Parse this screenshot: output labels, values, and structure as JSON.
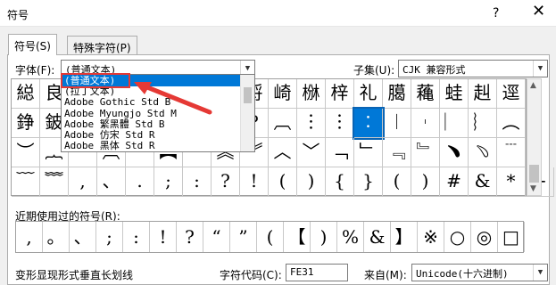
{
  "window": {
    "title": "符号",
    "help": "?",
    "close": "✕"
  },
  "tabs": [
    {
      "label": "符号(S)",
      "active": true
    },
    {
      "label": "特殊字符(P)",
      "active": false
    }
  ],
  "font": {
    "label": "字体(F):",
    "value": "(普通文本)"
  },
  "subset": {
    "label": "子集(U):",
    "value": "CJK 兼容形式"
  },
  "dropdown_items": [
    "(普通文本)",
    "(拉丁文本)",
    "Adobe Gothic Std B",
    "Adobe Myungjo Std M",
    "Adobe 繁黑體 Std B",
    "Adobe 仿宋 Std R",
    "Adobe 黑体 Std R"
  ],
  "grid_rows": [
    [
      "縂",
      "良",
      "",
      "",
      "",
      "",
      "",
      "",
      "埒",
      "崎",
      "椕",
      "梓",
      "礼",
      "臈",
      "蘒",
      "蛙",
      "赳",
      "逕"
    ],
    [
      "錚",
      "鈹",
      "",
      "",
      "",
      "",
      "",
      "",
      "?",
      "︹",
      "︙",
      "︙",
      "︰",
      "︱",
      "︲",
      "︳",
      "︴",
      "︵"
    ],
    [
      "︶",
      "︷",
      "︸",
      "︹",
      "︺",
      "︻",
      "︼",
      "︽",
      "︾",
      "︿",
      "﹀",
      "﹁",
      "﹂",
      "﹃",
      "﹄",
      "﹅",
      "﹆",
      "﹉"
    ],
    [
      "﹋",
      "﹌",
      ",",
      "、",
      ".",
      ";",
      ":",
      "?",
      "!",
      "(",
      ")",
      "{",
      "}",
      "(",
      ")",
      "#",
      "&",
      "*",
      "+"
    ]
  ],
  "recent": {
    "label": "近期使用过的符号(R):",
    "symbols": [
      ",",
      "。",
      "、",
      ";",
      ":",
      "!",
      "?",
      "“",
      "”",
      "(",
      "【",
      ")",
      "%",
      "&",
      "】",
      "※",
      "○",
      "◎",
      "□"
    ]
  },
  "footer": {
    "char_name": "变形显现形式垂直长划线",
    "code_label": "字符代码(C):",
    "code_value": "FE31",
    "from_label": "来自(M):",
    "from_value": "Unicode(十六进制)"
  }
}
